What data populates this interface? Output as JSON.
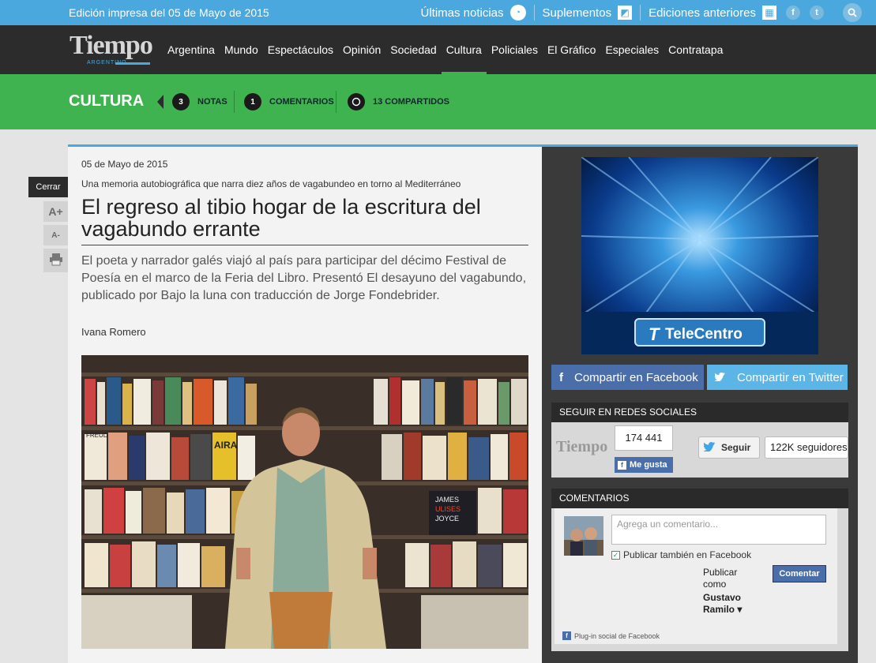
{
  "topbar": {
    "edition": "Edición impresa del 05 de Mayo de 2015",
    "links": [
      {
        "label": "Últimas noticias",
        "icon": "clock-icon"
      },
      {
        "label": "Suplementos",
        "icon": "document-icon"
      },
      {
        "label": "Ediciones anteriores",
        "icon": "calendar-icon"
      }
    ],
    "facebook_icon": "f",
    "twitter_icon": "t"
  },
  "logo": {
    "word": "Tiempo",
    "sub": "ARGENTINO"
  },
  "nav": {
    "items": [
      "Argentina",
      "Mundo",
      "Espectáculos",
      "Opinión",
      "Sociedad",
      "Cultura",
      "Policiales",
      "El Gráfico",
      "Especiales",
      "Contratapa"
    ],
    "active": "Cultura"
  },
  "section": {
    "name": "CULTURA",
    "notas_count": "3",
    "notas_label": "NOTAS",
    "comentarios_count": "1",
    "comentarios_label": "COMENTARIOS",
    "compartidos_label": "13 COMPARTIDOS"
  },
  "tools": {
    "close": "Cerrar",
    "font_up": "A+",
    "font_down": "A-"
  },
  "article": {
    "date": "05 de Mayo de 2015",
    "kicker": "Una memoria autobiográfica que narra diez años de vagabundeo en torno al Mediterráneo",
    "headline": "El regreso al tibio hogar de la escritura del vagabundo errante",
    "summary": "El poeta y narrador galés viajó al país para participar del décimo Festival de Poesía en el marco de la Feria del Libro. Presentó El desayuno del vagabundo, publicado por Bajo la luna con traducción de Jorge Fondebrider.",
    "author": "Ivana Romero",
    "photo_book_labels": [
      "FREUD",
      "AIRA",
      "JAMES",
      "ULISES",
      "JOYCE"
    ]
  },
  "sidebar": {
    "ad_brand": "TeleCentro",
    "share_facebook": "Compartir en Facebook",
    "share_twitter": "Compartir en Twitter",
    "social_head": "SEGUIR EN REDES SOCIALES",
    "likes": "174 441",
    "like_label": "Me gusta",
    "follow_label": "Seguir",
    "followers": "122K seguidores",
    "comments_head": "COMENTARIOS",
    "comment_placeholder": "Agrega un comentario...",
    "publish_fb": "Publicar también en Facebook",
    "publish_as": "Publicar como",
    "user_name": "Gustavo Ramilo",
    "comment_button": "Comentar",
    "plugin_label": "Plug-in social de Facebook"
  },
  "colors": {
    "topbar": "#4aa8de",
    "nav": "#2c2c2c",
    "section": "#3fb34f",
    "facebook": "#4a6ea9",
    "twitter": "#5bb5e6"
  }
}
